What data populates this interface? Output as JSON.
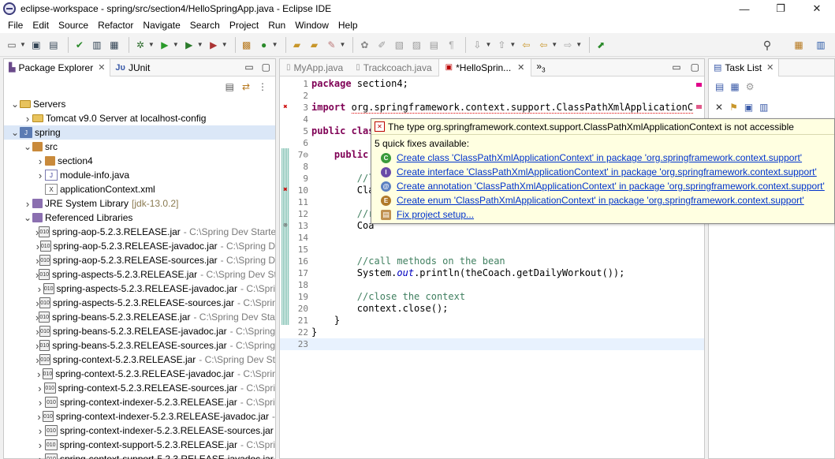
{
  "window": {
    "title": "eclipse-workspace - spring/src/section4/HelloSpringApp.java - Eclipse IDE",
    "minimize": "—",
    "restore": "❐",
    "close": "✕"
  },
  "menu": [
    "File",
    "Edit",
    "Source",
    "Refactor",
    "Navigate",
    "Search",
    "Project",
    "Run",
    "Window",
    "Help"
  ],
  "package_explorer": {
    "tabs": [
      {
        "label": "Package Explorer",
        "active": true,
        "icon": "package-explorer-icon"
      },
      {
        "label": "JUnit",
        "active": false,
        "icon": "junit-icon"
      }
    ],
    "tree": [
      {
        "indent": 0,
        "arrow": "down",
        "icon": "folder",
        "label": "Servers",
        "decor": ""
      },
      {
        "indent": 1,
        "arrow": "right",
        "icon": "folder",
        "label": "Tomcat v9.0 Server at localhost-config",
        "decor": ""
      },
      {
        "indent": 0,
        "arrow": "down",
        "icon": "project",
        "label": "spring",
        "decor": "",
        "selected": true
      },
      {
        "indent": 1,
        "arrow": "down",
        "icon": "srcfolder",
        "label": "src",
        "decor": ""
      },
      {
        "indent": 2,
        "arrow": "right",
        "icon": "package",
        "label": "section4",
        "decor": ""
      },
      {
        "indent": 2,
        "arrow": "right",
        "icon": "java",
        "label": "module-info.java",
        "decor": ""
      },
      {
        "indent": 2,
        "arrow": "",
        "icon": "xml",
        "label": "applicationContext.xml",
        "decor": ""
      },
      {
        "indent": 1,
        "arrow": "right",
        "icon": "library",
        "label": "JRE System Library",
        "decor": "[jdk-13.0.2]"
      },
      {
        "indent": 1,
        "arrow": "down",
        "icon": "library",
        "label": "Referenced Libraries",
        "decor": ""
      },
      {
        "indent": 2,
        "arrow": "right",
        "icon": "jar",
        "label": "spring-aop-5.2.3.RELEASE.jar",
        "decor": "- C:\\Spring Dev Starte"
      },
      {
        "indent": 2,
        "arrow": "right",
        "icon": "jar",
        "label": "spring-aop-5.2.3.RELEASE-javadoc.jar",
        "decor": "- C:\\Spring D"
      },
      {
        "indent": 2,
        "arrow": "right",
        "icon": "jar",
        "label": "spring-aop-5.2.3.RELEASE-sources.jar",
        "decor": "- C:\\Spring D"
      },
      {
        "indent": 2,
        "arrow": "right",
        "icon": "jar",
        "label": "spring-aspects-5.2.3.RELEASE.jar",
        "decor": "- C:\\Spring Dev St"
      },
      {
        "indent": 2,
        "arrow": "right",
        "icon": "jar",
        "label": "spring-aspects-5.2.3.RELEASE-javadoc.jar",
        "decor": "- C:\\Spri"
      },
      {
        "indent": 2,
        "arrow": "right",
        "icon": "jar",
        "label": "spring-aspects-5.2.3.RELEASE-sources.jar",
        "decor": "- C:\\Sprir"
      },
      {
        "indent": 2,
        "arrow": "right",
        "icon": "jar",
        "label": "spring-beans-5.2.3.RELEASE.jar",
        "decor": "- C:\\Spring Dev Star"
      },
      {
        "indent": 2,
        "arrow": "right",
        "icon": "jar",
        "label": "spring-beans-5.2.3.RELEASE-javadoc.jar",
        "decor": "- C:\\Spring"
      },
      {
        "indent": 2,
        "arrow": "right",
        "icon": "jar",
        "label": "spring-beans-5.2.3.RELEASE-sources.jar",
        "decor": "- C:\\Spring"
      },
      {
        "indent": 2,
        "arrow": "right",
        "icon": "jar",
        "label": "spring-context-5.2.3.RELEASE.jar",
        "decor": "- C:\\Spring Dev St"
      },
      {
        "indent": 2,
        "arrow": "right",
        "icon": "jar",
        "label": "spring-context-5.2.3.RELEASE-javadoc.jar",
        "decor": "- C:\\Sprir"
      },
      {
        "indent": 2,
        "arrow": "right",
        "icon": "jar",
        "label": "spring-context-5.2.3.RELEASE-sources.jar",
        "decor": "- C:\\Spri"
      },
      {
        "indent": 2,
        "arrow": "right",
        "icon": "jar",
        "label": "spring-context-indexer-5.2.3.RELEASE.jar",
        "decor": "- C:\\Spri"
      },
      {
        "indent": 2,
        "arrow": "right",
        "icon": "jar",
        "label": "spring-context-indexer-5.2.3.RELEASE-javadoc.jar",
        "decor": "-"
      },
      {
        "indent": 2,
        "arrow": "right",
        "icon": "jar",
        "label": "spring-context-indexer-5.2.3.RELEASE-sources.jar",
        "decor": ""
      },
      {
        "indent": 2,
        "arrow": "right",
        "icon": "jar",
        "label": "spring-context-support-5.2.3.RELEASE.jar",
        "decor": "- C:\\Spri"
      },
      {
        "indent": 2,
        "arrow": "right",
        "icon": "jar",
        "label": "spring-context-support-5.2.3.RELEASE-javadoc.jar",
        "decor": ""
      }
    ]
  },
  "editor": {
    "tabs": [
      {
        "label": "MyApp.java",
        "active": false
      },
      {
        "label": "Trackcoach.java",
        "active": false
      },
      {
        "label": "*HelloSprin...",
        "active": true
      }
    ],
    "overflow": "»",
    "overflow_count": "3",
    "lines": [
      {
        "n": "1",
        "mark": "",
        "html": "<span class=\"kw\">package</span> section4;"
      },
      {
        "n": "2",
        "mark": "",
        "html": ""
      },
      {
        "n": "3",
        "mark": "error",
        "html": "<span class=\"kw\">import</span> <span class=\"err\">org.springframework.context.support.ClassPathXmlApplicationC</span>"
      },
      {
        "n": "4",
        "mark": "",
        "html": ""
      },
      {
        "n": "5",
        "mark": "",
        "html": "<span class=\"kw\">public</span> <span class=\"kw\">clas</span>"
      },
      {
        "n": "6",
        "mark": "",
        "html": ""
      },
      {
        "n": "7⊖",
        "mark": "",
        "html": "    <span class=\"kw\">public</span>"
      },
      {
        "n": "8",
        "mark": "",
        "html": ""
      },
      {
        "n": "9",
        "mark": "",
        "html": "        <span class=\"cm\">//l</span>"
      },
      {
        "n": "10",
        "mark": "error",
        "html": "        Cla"
      },
      {
        "n": "11",
        "mark": "",
        "html": ""
      },
      {
        "n": "12",
        "mark": "",
        "html": "        <span class=\"cm\">//r</span>"
      },
      {
        "n": "13",
        "mark": "errorx",
        "html": "        Coa"
      },
      {
        "n": "14",
        "mark": "",
        "html": ""
      },
      {
        "n": "15",
        "mark": "",
        "html": ""
      },
      {
        "n": "16",
        "mark": "",
        "html": "        <span class=\"cm\">//call methods on the bean</span>"
      },
      {
        "n": "17",
        "mark": "",
        "html": "        System.<span class=\"fld\">out</span>.println(theCoach.getDailyWorkout());"
      },
      {
        "n": "18",
        "mark": "",
        "html": ""
      },
      {
        "n": "19",
        "mark": "",
        "html": "        <span class=\"cm\">//close the context</span>"
      },
      {
        "n": "20",
        "mark": "",
        "html": "        context.close();"
      },
      {
        "n": "21",
        "mark": "",
        "html": "    }"
      },
      {
        "n": "22",
        "mark": "",
        "html": "}"
      },
      {
        "n": "23",
        "mark": "",
        "html": "",
        "current": true
      }
    ]
  },
  "tasklist": {
    "tabs": [
      {
        "label": "Task List",
        "active": true
      }
    ]
  },
  "popup": {
    "message": "The type org.springframework.context.support.ClassPathXmlApplicationContext is not accessible",
    "quick_fix_title": "5 quick fixes available:",
    "fixes": [
      {
        "kind": "class",
        "letter": "C",
        "color": "#3a9a3a",
        "label": "Create class 'ClassPathXmlApplicationContext' in package 'org.springframework.context.support'"
      },
      {
        "kind": "interface",
        "letter": "I",
        "color": "#6a4aa8",
        "label": "Create interface 'ClassPathXmlApplicationContext' in package 'org.springframework.context.support'"
      },
      {
        "kind": "annotation",
        "letter": "@",
        "color": "#5a7fc0",
        "label": "Create annotation 'ClassPathXmlApplicationContext' in package 'org.springframework.context.support'"
      },
      {
        "kind": "enum",
        "letter": "E",
        "color": "#b07a2a",
        "label": "Create enum 'ClassPathXmlApplicationContext' in package 'org.springframework.context.support'"
      },
      {
        "kind": "setup",
        "letter": "",
        "color": "#c09050",
        "label": "Fix project setup..."
      }
    ]
  }
}
